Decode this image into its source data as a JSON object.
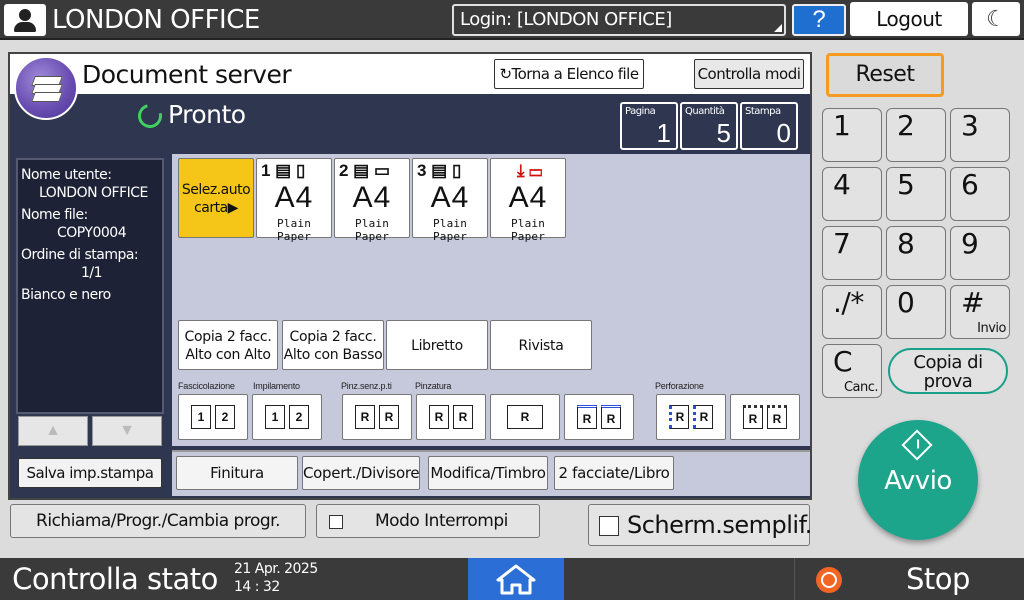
{
  "topbar": {
    "app_title": "LONDON OFFICE",
    "login_label": "Login: [LONDON OFFICE]",
    "help_label": "?",
    "logout_label": "Logout",
    "night_label": "☾"
  },
  "header": {
    "title": "Document server",
    "return_button": "↻Torna a Elenco file",
    "modes_button": "Controlla modi",
    "status": "Pronto"
  },
  "counters": [
    {
      "label": "Pagina",
      "value": "1"
    },
    {
      "label": "Quantità",
      "value": "5"
    },
    {
      "label": "Stampa",
      "value": "0"
    }
  ],
  "info": {
    "user_label": "Nome utente:",
    "user_value": "LONDON OFFICE",
    "file_label": "Nome file:",
    "file_value": "COPY0004",
    "order_label": "Ordine di stampa:",
    "order_value": "1/1",
    "color_mode": "Bianco e nero",
    "up_label": "▲",
    "down_label": "▼",
    "save_button": "Salva imp.stampa"
  },
  "paper": {
    "auto_line1": "Selez.auto",
    "auto_line2": "carta▶",
    "trays": [
      {
        "icons": "1 ▤ ▯",
        "size": "A4",
        "type": "Plain Paper"
      },
      {
        "icons": "2 ▤ ▭",
        "size": "A4",
        "type": "Plain Paper"
      },
      {
        "icons": "3 ▤ ▯",
        "size": "A4",
        "type": "Plain Paper"
      },
      {
        "icons": "⤓ ▭",
        "size": "A4",
        "type": "Plain Paper"
      }
    ]
  },
  "duplex": [
    {
      "line1": "Copia 2 facc.",
      "line2": "Alto con Alto"
    },
    {
      "line1": "Copia 2 facc.",
      "line2": "Alto con Basso"
    },
    {
      "line1": "Libretto",
      "line2": ""
    },
    {
      "line1": "Rivista",
      "line2": ""
    }
  ],
  "finishing_labels": {
    "collate": "Fascicolazione",
    "stack": "Impilamento",
    "staple_less": "Pinz.senz.p.ti",
    "staple": "Pinzatura",
    "punch": "Perforazione"
  },
  "tabs": [
    "Finitura",
    "Copert./Divisore",
    "Modifica/Timbro",
    "2 facciate/Libro"
  ],
  "bottom": {
    "recall_button": "Richiama/Progr./Cambia progr.",
    "interrupt_button": "Modo Interrompi",
    "simple_screen": "Scherm.semplif."
  },
  "keypad": {
    "reset": "Reset",
    "keys": [
      "1",
      "2",
      "3",
      "4",
      "5",
      "6",
      "7",
      "8",
      "9",
      "./*",
      "0",
      "#"
    ],
    "hash_sub": "Invio",
    "clear": "C",
    "clear_sub": "Canc.",
    "proof_line1": "Copia di",
    "proof_line2": "prova",
    "start": "Avvio"
  },
  "statusbar": {
    "check_status": "Controlla stato",
    "date": "21 Apr. 2025",
    "time": "14 : 32",
    "stop": "Stop"
  },
  "colors": {
    "accent_orange": "#f59a23",
    "start_green": "#1da58c",
    "auto_paper_yellow": "#f5c518",
    "home_blue": "#2b6fd6",
    "stop_orange": "#f26522"
  }
}
